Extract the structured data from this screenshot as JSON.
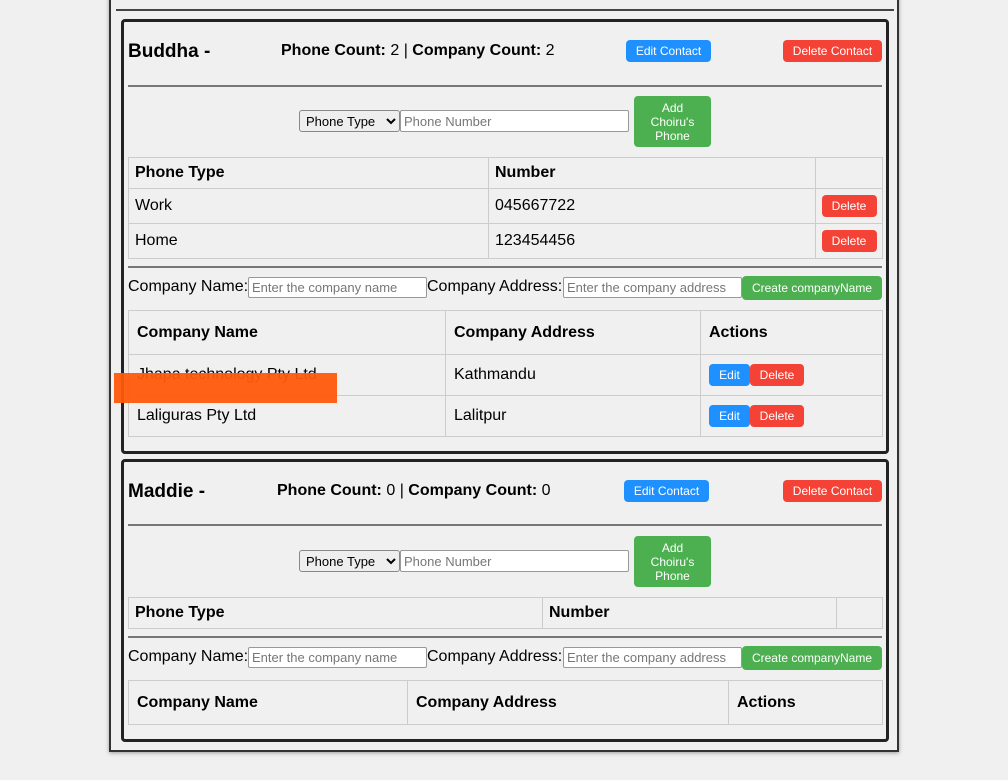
{
  "contacts": [
    {
      "name": "Buddha -",
      "phone_count_label": "Phone Count:",
      "phone_count": "2",
      "separator": "|",
      "company_count_label": "Company Count:",
      "company_count": "2",
      "edit_label": "Edit Contact",
      "delete_label": "Delete Contact",
      "phone_type_selected": "Phone Type",
      "phone_placeholder": "Phone Number",
      "add_phone_label": "Add Choiru's Phone",
      "phone_headers": [
        "Phone Type",
        "Number",
        ""
      ],
      "phones": [
        {
          "type": "Work",
          "number": "045667722",
          "delete": "Delete"
        },
        {
          "type": "Home",
          "number": "123454456",
          "delete": "Delete"
        }
      ],
      "company_name_label": "Company Name:",
      "company_name_placeholder": "Enter the company name",
      "company_address_label": "Company Address:",
      "company_address_placeholder": "Enter the company address",
      "create_company_label": "Create companyName",
      "company_headers": [
        "Company Name",
        "Company Address",
        "Actions"
      ],
      "companies": [
        {
          "name": "Jhapa technology Pty Ltd",
          "address": "Kathmandu",
          "edit": "Edit",
          "delete": "Delete"
        },
        {
          "name": "Laliguras Pty Ltd",
          "address": "Lalitpur",
          "edit": "Edit",
          "delete": "Delete"
        }
      ]
    },
    {
      "name": "Maddie -",
      "phone_count_label": "Phone Count:",
      "phone_count": "0",
      "separator": "|",
      "company_count_label": "Company Count:",
      "company_count": "0",
      "edit_label": "Edit Contact",
      "delete_label": "Delete Contact",
      "phone_type_selected": "Phone Type",
      "phone_placeholder": "Phone Number",
      "add_phone_label": "Add Choiru's Phone",
      "phone_headers": [
        "Phone Type",
        "Number",
        ""
      ],
      "phones": [],
      "company_name_label": "Company Name:",
      "company_name_placeholder": "Enter the company name",
      "company_address_label": "Company Address:",
      "company_address_placeholder": "Enter the company address",
      "create_company_label": "Create companyName",
      "company_headers": [
        "Company Name",
        "Company Address",
        "Actions"
      ],
      "companies": []
    }
  ],
  "colors": {
    "blue": "#1e90ff",
    "red": "#f44336",
    "green": "#4caf50",
    "redaction": "#ff5a0a"
  }
}
